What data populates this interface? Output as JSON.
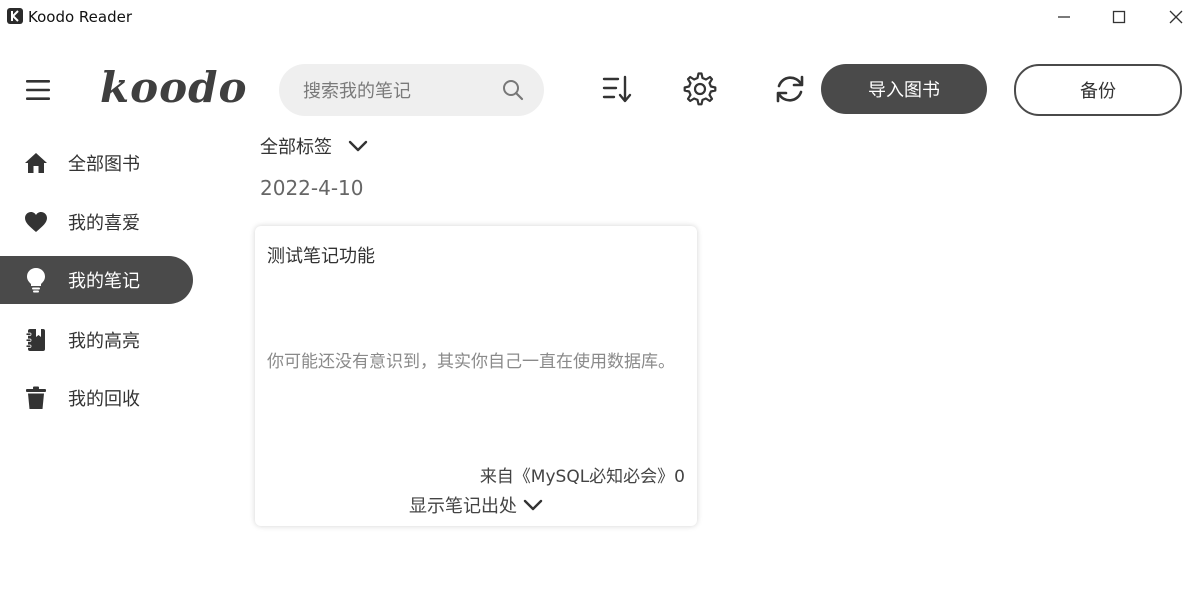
{
  "window": {
    "title": "Koodo Reader",
    "controls": [
      "minimize-icon",
      "maximize-icon",
      "close-icon"
    ]
  },
  "header": {
    "logo_text": "koodo",
    "search": {
      "placeholder": "搜索我的笔记",
      "value": ""
    },
    "icons": [
      "menu-icon",
      "search-icon",
      "sort-icon",
      "gear-icon",
      "sync-icon"
    ],
    "import_label": "导入图书",
    "backup_label": "备份"
  },
  "sidebar": {
    "items": [
      {
        "label": "全部图书",
        "icon": "home-icon",
        "active": false
      },
      {
        "label": "我的喜爱",
        "icon": "heart-icon",
        "active": false
      },
      {
        "label": "我的笔记",
        "icon": "lightbulb-icon",
        "active": true
      },
      {
        "label": "我的高亮",
        "icon": "highlight-book-icon",
        "active": false
      },
      {
        "label": "我的回收",
        "icon": "trash-icon",
        "active": false
      }
    ]
  },
  "main": {
    "tag_filter_label": "全部标签",
    "date": "2022-4-10",
    "note": {
      "title": "测试笔记功能",
      "text": "你可能还没有意识到，其实你自己一直在使用数据库。",
      "source": "来自《MySQL必知必会》0",
      "toggle_label": "显示笔记出处"
    }
  },
  "colors": {
    "accent_dark": "#4a4a4a",
    "search_bg": "#efefef",
    "muted_text": "#8a8a8a"
  }
}
